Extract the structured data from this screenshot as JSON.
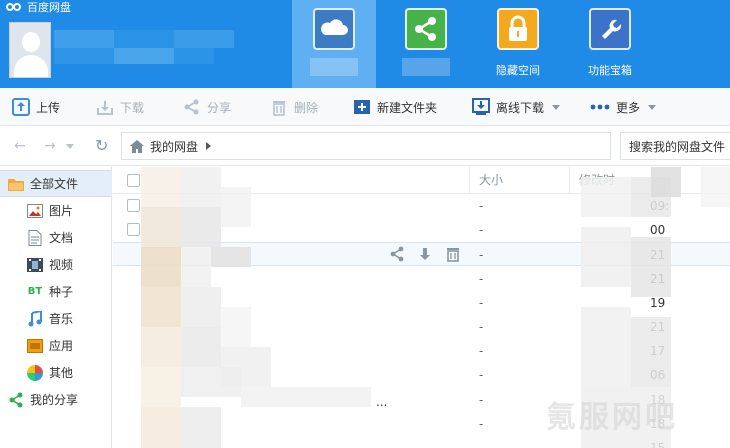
{
  "app": {
    "title": "百度网盘"
  },
  "user": {
    "name": ""
  },
  "nav": {
    "tabs": [
      {
        "label": "",
        "icon": "cloud-icon",
        "active": true
      },
      {
        "label": "",
        "icon": "share-icon",
        "active": false
      },
      {
        "label": "隐藏空间",
        "icon": "lock-icon",
        "active": false
      },
      {
        "label": "功能宝箱",
        "icon": "wrench-icon",
        "active": false
      }
    ]
  },
  "toolbar": {
    "upload": "上传",
    "download": "下载",
    "share": "分享",
    "delete": "删除",
    "new_folder": "新建文件夹",
    "offline_download": "离线下载",
    "more": "更多"
  },
  "address": {
    "breadcrumb": "我的网盘",
    "search_value": "搜索我的网盘文件"
  },
  "sidebar": {
    "items": [
      {
        "label": "全部文件",
        "icon": "folder-icon",
        "active": true
      },
      {
        "label": "图片",
        "icon": "image-icon"
      },
      {
        "label": "文档",
        "icon": "document-icon"
      },
      {
        "label": "视频",
        "icon": "video-icon"
      },
      {
        "label": "种子",
        "icon": "bt-icon",
        "badge": "BT"
      },
      {
        "label": "音乐",
        "icon": "music-icon"
      },
      {
        "label": "应用",
        "icon": "app-icon"
      },
      {
        "label": "其他",
        "icon": "other-icon"
      },
      {
        "label": "我的分享",
        "icon": "share-icon"
      }
    ]
  },
  "list": {
    "headers": {
      "name": "",
      "size": "大小",
      "modified": "修改时"
    },
    "rows": [
      {
        "size": "-",
        "modified": "09:"
      },
      {
        "size": "-",
        "modified": "00"
      },
      {
        "size": "-",
        "modified": "21"
      },
      {
        "size": "-",
        "modified": "21"
      },
      {
        "size": "-",
        "modified": "19"
      },
      {
        "size": "-",
        "modified": "21"
      },
      {
        "size": "-",
        "modified": "17"
      },
      {
        "size": "-",
        "modified": "06"
      },
      {
        "size": "-",
        "modified": "18"
      },
      {
        "size": "-",
        "modified": "18"
      },
      {
        "size": "-",
        "modified": "15"
      }
    ],
    "truncation": "..."
  },
  "watermark": "氪服网吧",
  "colors": {
    "header": "#1f8be6",
    "accent": "#3b8fd9",
    "active_nav": "#5fb0f2"
  }
}
